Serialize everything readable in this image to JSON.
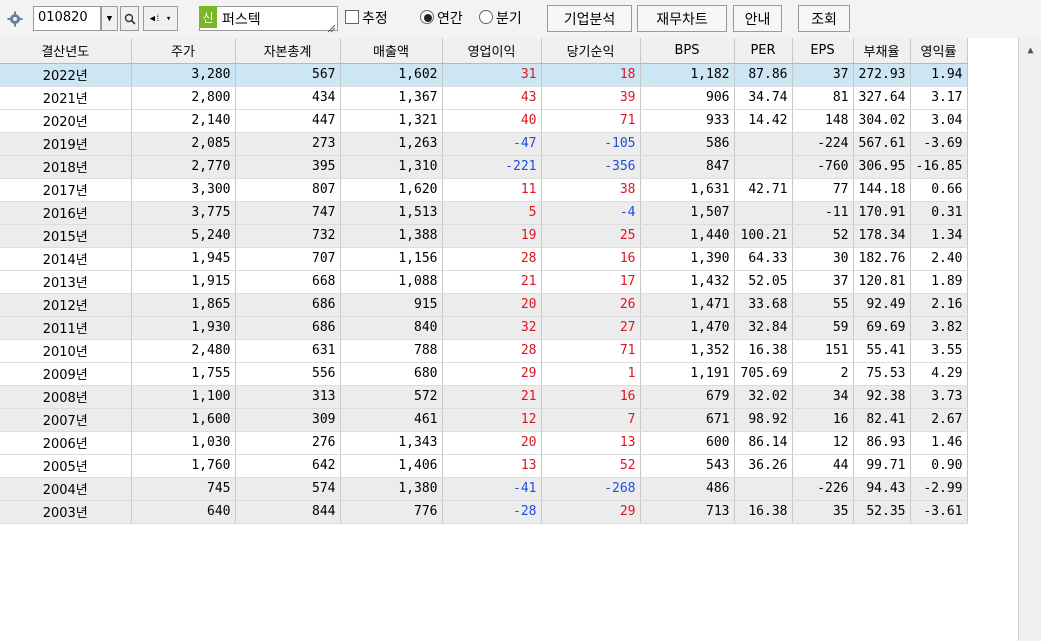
{
  "toolbar": {
    "code": "010820",
    "new_badge": "신",
    "company": "퍼스텍",
    "estimate_label": "추정",
    "annual_label": "연간",
    "quarter_label": "분기",
    "buttons": [
      "기업분석",
      "재무차트",
      "안내",
      "조회"
    ]
  },
  "columns": [
    "결산년도",
    "주가",
    "자본총계",
    "매출액",
    "영업이익",
    "당기순익",
    "BPS",
    "PER",
    "EPS",
    "부채율",
    "영익률"
  ],
  "rows": [
    [
      "2022년",
      "3,280",
      "567",
      "1,602",
      "31",
      "18",
      "1,182",
      "87.86",
      "37",
      "272.93",
      "1.94"
    ],
    [
      "2021년",
      "2,800",
      "434",
      "1,367",
      "43",
      "39",
      "906",
      "34.74",
      "81",
      "327.64",
      "3.17"
    ],
    [
      "2020년",
      "2,140",
      "447",
      "1,321",
      "40",
      "71",
      "933",
      "14.42",
      "148",
      "304.02",
      "3.04"
    ],
    [
      "2019년",
      "2,085",
      "273",
      "1,263",
      "-47",
      "-105",
      "586",
      "",
      "-224",
      "567.61",
      "-3.69"
    ],
    [
      "2018년",
      "2,770",
      "395",
      "1,310",
      "-221",
      "-356",
      "847",
      "",
      "-760",
      "306.95",
      "-16.85"
    ],
    [
      "2017년",
      "3,300",
      "807",
      "1,620",
      "11",
      "38",
      "1,631",
      "42.71",
      "77",
      "144.18",
      "0.66"
    ],
    [
      "2016년",
      "3,775",
      "747",
      "1,513",
      "5",
      "-4",
      "1,507",
      "",
      "-11",
      "170.91",
      "0.31"
    ],
    [
      "2015년",
      "5,240",
      "732",
      "1,388",
      "19",
      "25",
      "1,440",
      "100.21",
      "52",
      "178.34",
      "1.34"
    ],
    [
      "2014년",
      "1,945",
      "707",
      "1,156",
      "28",
      "16",
      "1,390",
      "64.33",
      "30",
      "182.76",
      "2.40"
    ],
    [
      "2013년",
      "1,915",
      "668",
      "1,088",
      "21",
      "17",
      "1,432",
      "52.05",
      "37",
      "120.81",
      "1.89"
    ],
    [
      "2012년",
      "1,865",
      "686",
      "915",
      "20",
      "26",
      "1,471",
      "33.68",
      "55",
      "92.49",
      "2.16"
    ],
    [
      "2011년",
      "1,930",
      "686",
      "840",
      "32",
      "27",
      "1,470",
      "32.84",
      "59",
      "69.69",
      "3.82"
    ],
    [
      "2010년",
      "2,480",
      "631",
      "788",
      "28",
      "71",
      "1,352",
      "16.38",
      "151",
      "55.41",
      "3.55"
    ],
    [
      "2009년",
      "1,755",
      "556",
      "680",
      "29",
      "1",
      "1,191",
      "705.69",
      "2",
      "75.53",
      "4.29"
    ],
    [
      "2008년",
      "1,100",
      "313",
      "572",
      "21",
      "16",
      "679",
      "32.02",
      "34",
      "92.38",
      "3.73"
    ],
    [
      "2007년",
      "1,600",
      "309",
      "461",
      "12",
      "7",
      "671",
      "98.92",
      "16",
      "82.41",
      "2.67"
    ],
    [
      "2006년",
      "1,030",
      "276",
      "1,343",
      "20",
      "13",
      "600",
      "86.14",
      "12",
      "86.93",
      "1.46"
    ],
    [
      "2005년",
      "1,760",
      "642",
      "1,406",
      "13",
      "52",
      "543",
      "36.26",
      "44",
      "99.71",
      "0.90"
    ],
    [
      "2004년",
      "745",
      "574",
      "1,380",
      "-41",
      "-268",
      "486",
      "",
      "-226",
      "94.43",
      "-2.99"
    ],
    [
      "2003년",
      "640",
      "844",
      "776",
      "-28",
      "29",
      "713",
      "16.38",
      "35",
      "52.35",
      "-3.61"
    ]
  ],
  "colors": {
    "positive": "#e0141e",
    "negative": "#1e4fd8",
    "selected_row": "#cde6f3",
    "alt_row": "#ececec",
    "badge": "#7bb528"
  }
}
